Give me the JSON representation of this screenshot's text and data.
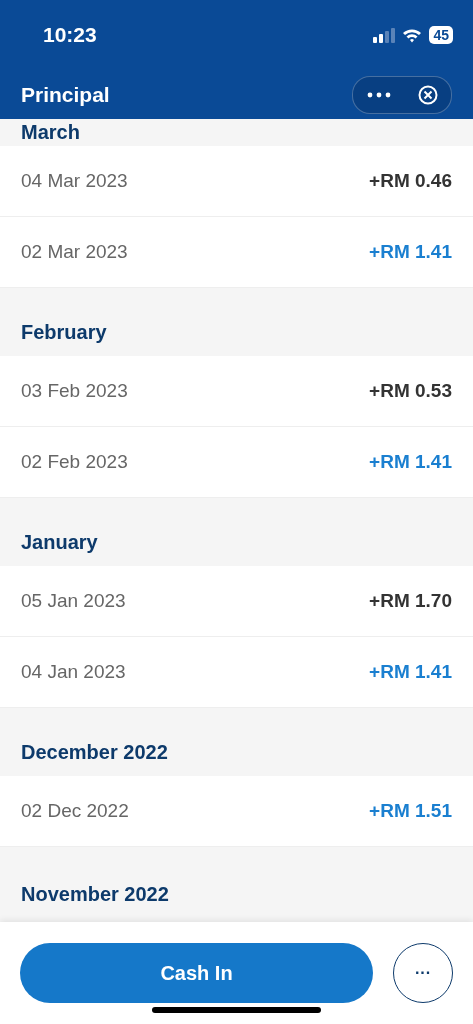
{
  "status_bar": {
    "time": "10:23",
    "battery": "45"
  },
  "header": {
    "title": "Principal"
  },
  "sections": [
    {
      "title": "March",
      "entries": [
        {
          "date": "04 Mar 2023",
          "amount": "+RM 0.46",
          "color": "#333333"
        },
        {
          "date": "02 Mar 2023",
          "amount": "+RM 1.41",
          "color": "#1a7fd0"
        }
      ]
    },
    {
      "title": "February",
      "entries": [
        {
          "date": "03 Feb 2023",
          "amount": "+RM 0.53",
          "color": "#333333"
        },
        {
          "date": "02 Feb 2023",
          "amount": "+RM 1.41",
          "color": "#1a7fd0"
        }
      ]
    },
    {
      "title": "January",
      "entries": [
        {
          "date": "05 Jan 2023",
          "amount": "+RM 1.70",
          "color": "#333333"
        },
        {
          "date": "04 Jan 2023",
          "amount": "+RM 1.41",
          "color": "#1a7fd0"
        }
      ]
    },
    {
      "title": "December 2022",
      "entries": [
        {
          "date": "02 Dec 2022",
          "amount": "+RM 1.51",
          "color": "#1a7fd0"
        }
      ]
    },
    {
      "title": "November 2022"
    }
  ],
  "footer": {
    "primary_button": "Cash In",
    "more_button": "···"
  }
}
